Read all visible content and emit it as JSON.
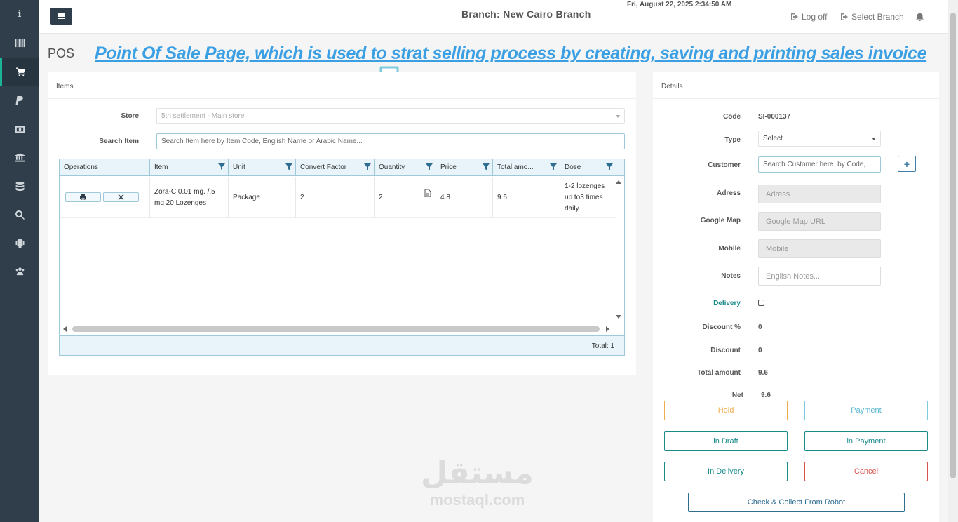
{
  "topbar": {
    "branch_label": "Branch:  New Cairo Branch",
    "datetime": "Fri, August 22, 2025 2:34:50 AM",
    "logoff_label": "Log off",
    "select_branch_label": "Select Branch"
  },
  "page": {
    "title": "POS",
    "annotation": "Point Of Sale Page, which is used to strat selling process by creating, saving and printing sales invoice"
  },
  "items_panel": {
    "heading": "Items",
    "store_label": "Store",
    "store_value": "5th settlement - Main store",
    "search_label": "Search Item",
    "search_placeholder": "Search Item here by Item Code, English Name or Arabic Name..."
  },
  "grid": {
    "columns": [
      "Operations",
      "Item",
      "Unit",
      "Convert Factor",
      "Quantity",
      "Price",
      "Total amo...",
      "Dose"
    ],
    "rows": [
      {
        "item": "Zora-C 0.01 mg. /.5 mg 20 Lozenges",
        "unit": "Package",
        "convert_factor": "2",
        "quantity": "2",
        "price": "4.8",
        "total_amount": "9.6",
        "dose": "1-2 lozenges up to3 times daily"
      }
    ],
    "footer_total": "Total: 1"
  },
  "details_panel": {
    "heading": "Details",
    "code_label": "Code",
    "code_value": "SI-000137",
    "type_label": "Type",
    "type_value": "Select",
    "customer_label": "Customer",
    "customer_placeholder": "Search Customer here  by Code, ...",
    "address_label": "Adress",
    "address_placeholder": "Adress",
    "map_label": "Google Map",
    "map_placeholder": "Google Map URL",
    "mobile_label": "Mobile",
    "mobile_placeholder": "Mobile",
    "notes_label": "Notes",
    "notes_placeholder": "English Notes...",
    "delivery_label": "Delivery",
    "discount_pct_label": "Discount %",
    "discount_pct_value": "0",
    "discount_label": "Discount",
    "discount_value": "0",
    "total_label": "Total amount",
    "total_value": "9.6",
    "net_label": "Net",
    "net_value": "9.6"
  },
  "actions": {
    "hold": "Hold",
    "payment": "Payment",
    "in_draft": "in Draft",
    "in_payment": "in Payment",
    "in_delivery": "In Delivery",
    "cancel": "Cancel",
    "robot": "Check & Collect From Robot"
  },
  "watermark": {
    "arabic": "مستقل",
    "english": "mostaql.com"
  },
  "colors": {
    "sidebar": "#2f3e4a",
    "accent_teal": "#1a8a8a",
    "hold_orange": "#f0ad4e",
    "cancel_red": "#d9534f",
    "annotation_blue": "#3b9fe3"
  }
}
